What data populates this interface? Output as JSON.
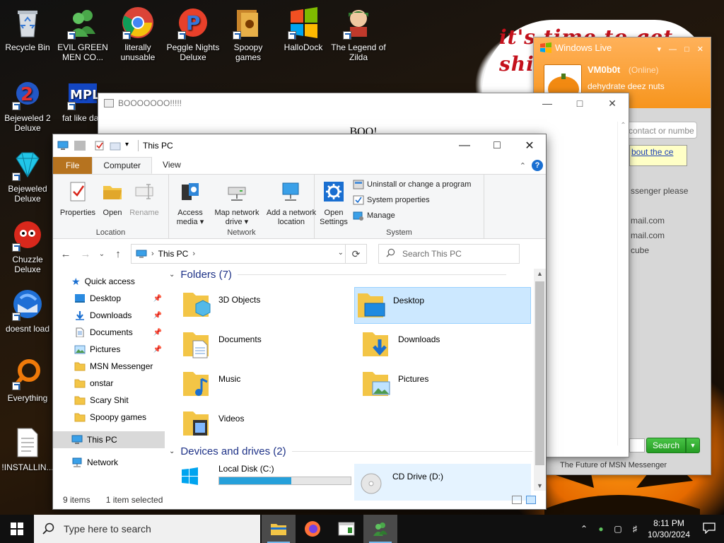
{
  "desktop": {
    "wallpaper_text": "it's time to get shit and or t",
    "icons": [
      {
        "label": "Recycle Bin",
        "icon": "recycle-bin-icon"
      },
      {
        "label": "EVIL GREEN MEN CO...",
        "icon": "msn-buddies-icon"
      },
      {
        "label": "literally unusable",
        "icon": "chrome-icon"
      },
      {
        "label": "Peggle Nights Deluxe",
        "icon": "peggle-icon"
      },
      {
        "label": "Spoopy games",
        "icon": "folder-icon"
      },
      {
        "label": "HalloDock",
        "icon": "windows-flag-icon"
      },
      {
        "label": "The Legend of Zilda",
        "icon": "zelda-icon"
      },
      {
        "label": "Bejeweled 2 Deluxe",
        "icon": "bejeweled2-icon"
      },
      {
        "label": "fat like darl",
        "icon": "mpl-icon"
      },
      {
        "label": "Bejeweled Deluxe",
        "icon": "gem-icon"
      },
      {
        "label": "Chuzzle Deluxe",
        "icon": "chuzzle-icon"
      },
      {
        "label": "doesnt load",
        "icon": "thunderbird-icon"
      },
      {
        "label": "Everything",
        "icon": "everything-icon"
      },
      {
        "label": "!INSTALLIN...",
        "icon": "text-file-icon"
      }
    ]
  },
  "boo_window": {
    "title": "BOOOOOOO!!!!!",
    "body": "BOO!"
  },
  "msn": {
    "brand": "Windows Live",
    "username": "VM0b0t",
    "status": "(Online)",
    "personal_message": "dehydrate deez nuts",
    "search_placeholder": "contact or numbe",
    "tip": "bout the ce",
    "rows": [
      "ssenger please",
      "mail.com",
      "mail.com",
      "cube"
    ],
    "search_button": "Search",
    "footer": "The Future of MSN Messenger"
  },
  "explorer": {
    "title": "This PC",
    "tabs": {
      "file": "File",
      "computer": "Computer",
      "view": "View"
    },
    "ribbon": {
      "location_group": "Location",
      "network_group": "Network",
      "system_group": "System",
      "properties": "Properties",
      "open": "Open",
      "rename": "Rename",
      "access_media_1": "Access",
      "access_media_2": "media ▾",
      "map_drive_1": "Map network",
      "map_drive_2": "drive ▾",
      "add_location_1": "Add a network",
      "add_location_2": "location",
      "open_settings_1": "Open",
      "open_settings_2": "Settings",
      "uninstall": "Uninstall or change a program",
      "system_properties": "System properties",
      "manage": "Manage"
    },
    "address": "This PC",
    "search_placeholder": "Search This PC",
    "nav": {
      "quick_access": "Quick access",
      "items": [
        "Desktop",
        "Downloads",
        "Documents",
        "Pictures",
        "MSN Messenger",
        "onstar",
        "Scary Shit",
        "Spoopy games"
      ],
      "this_pc": "This PC",
      "network": "Network"
    },
    "folders_header": "Folders (7)",
    "folders": [
      "3D Objects",
      "Desktop",
      "Documents",
      "Downloads",
      "Music",
      "Pictures",
      "Videos"
    ],
    "devices_header": "Devices and drives (2)",
    "drives": [
      {
        "name": "Local Disk (C:)",
        "used_fraction": 0.55
      },
      {
        "name": "CD Drive (D:)"
      }
    ],
    "status_items": "9 items",
    "status_selected": "1 item selected"
  },
  "taskbar": {
    "search_placeholder": "Type here to search",
    "time": "8:11 PM",
    "date": "10/30/2024"
  },
  "colors": {
    "accent": "#0078d7",
    "file_tab": "#b6731f",
    "selection": "#cce8ff",
    "msn_orange": "#f7951d"
  }
}
